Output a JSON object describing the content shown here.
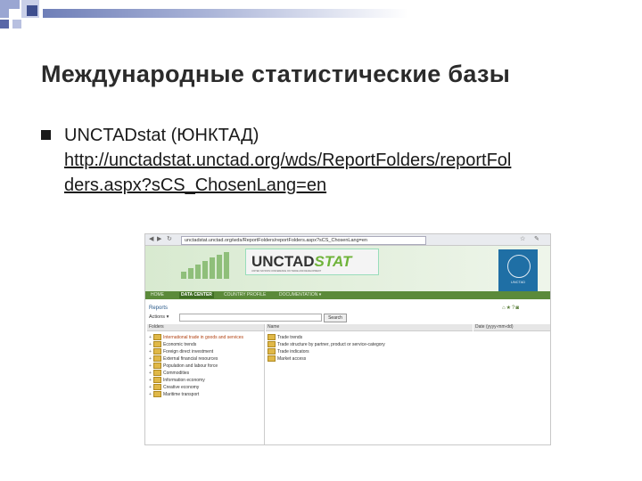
{
  "slide": {
    "title": "Международные статистические базы",
    "bullet": {
      "label": "UNCTADstat (ЮНКТАД)",
      "url_line1": "http://unctadstat.unctad.org/wds/ReportFolders/reportFol",
      "url_line2": "ders.aspx?sCS_ChosenLang=en"
    }
  },
  "screenshot": {
    "url": "unctadstat.unctad.org/wds/ReportFolders/reportFolders.aspx?sCS_ChosenLang=en",
    "logo_text_a": "UNCTAD",
    "logo_text_b": "STAT",
    "logo_sub": "UNITED NATIONS CONFERENCE ON TRADE AND DEVELOPMENT",
    "emblem_label": "UNCTAD",
    "menu": [
      "HOME",
      "DATA CENTER",
      "COUNTRY PROFILE",
      "DOCUMENTATION ▾"
    ],
    "reports_label": "Reports",
    "actions_label": "Actions ▾",
    "search_button": "Search",
    "tree_header": "Folders",
    "list_header": "Name",
    "date_header": "Date (yyyy-mm-dd)",
    "tree": [
      "International trade in goods and services",
      "Economic trends",
      "Foreign direct investment",
      "External financial resources",
      "Population and labour force",
      "Commodities",
      "Information economy",
      "Creative economy",
      "Maritime transport"
    ],
    "list": [
      "Trade trends",
      "Trade structure by partner, product or service-category",
      "Trade indicators",
      "Market access"
    ]
  }
}
